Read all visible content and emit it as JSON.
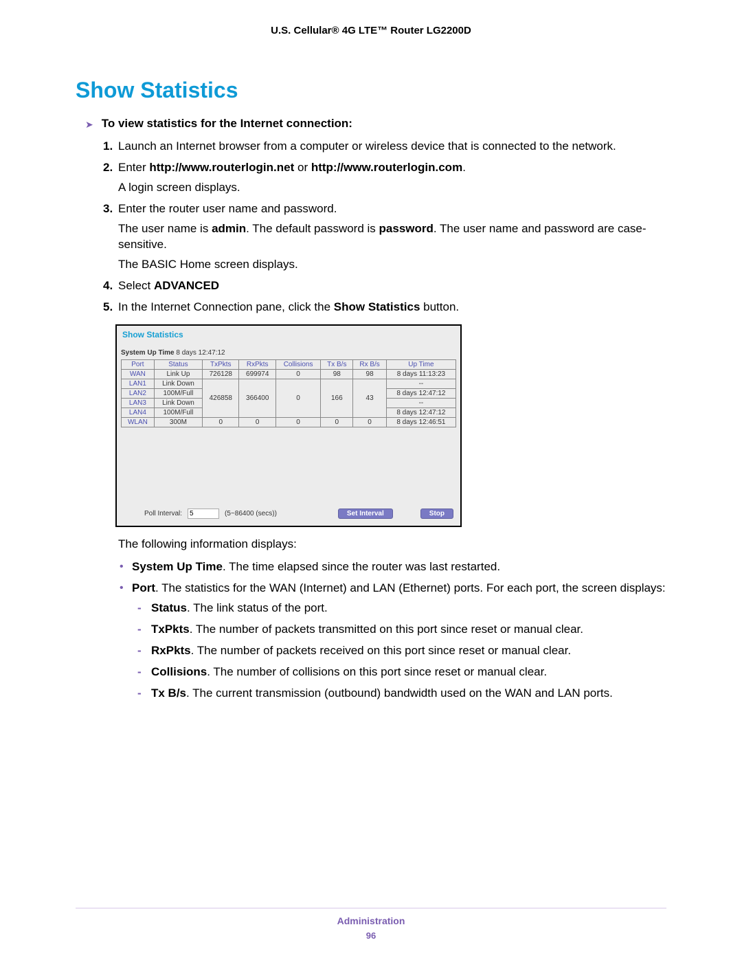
{
  "header": "U.S. Cellular® 4G LTE™ Router LG2200D",
  "section_title": "Show Statistics",
  "lead": "To view statistics for the Internet connection:",
  "steps": {
    "s1": {
      "num": "1.",
      "text": "Launch an Internet browser from a computer or wireless device that is connected to the network."
    },
    "s2": {
      "num": "2.",
      "pre": "Enter ",
      "b1": "http://www.routerlogin.net",
      "mid": " or ",
      "b2": "http://www.routerlogin.com",
      "post": ".",
      "p2": "A login screen displays."
    },
    "s3": {
      "num": "3.",
      "text": "Enter the router user name and password.",
      "p2a": "The user name is ",
      "p2b1": "admin",
      "p2c": ". The default password is ",
      "p2b2": "password",
      "p2d": ". The user name and password are case-sensitive.",
      "p3": "The BASIC Home screen displays."
    },
    "s4": {
      "num": "4.",
      "pre": "Select ",
      "b": "ADVANCED"
    },
    "s5": {
      "num": "5.",
      "pre": "In the Internet Connection pane, click the ",
      "b": "Show Statistics",
      "post": " button."
    }
  },
  "panel": {
    "title": "Show Statistics",
    "uptime_label": "System Up Time",
    "uptime_value": "8 days 12:47:12",
    "headers": [
      "Port",
      "Status",
      "TxPkts",
      "RxPkts",
      "Collisions",
      "Tx B/s",
      "Rx B/s",
      "Up Time"
    ],
    "rows": [
      [
        "WAN",
        "Link Up",
        "726128",
        "699974",
        "0",
        "98",
        "98",
        "8 days 11:13:23"
      ],
      [
        "LAN1",
        "Link Down",
        "",
        "",
        "",
        "",
        "",
        "--"
      ],
      [
        "LAN2",
        "100M/Full",
        "426858",
        "366400",
        "0",
        "166",
        "43",
        "8 days 12:47:12"
      ],
      [
        "LAN3",
        "Link Down",
        "",
        "",
        "",
        "",
        "",
        "--"
      ],
      [
        "LAN4",
        "100M/Full",
        "",
        "",
        "",
        "",
        "",
        "8 days 12:47:12"
      ],
      [
        "WLAN",
        "300M",
        "0",
        "0",
        "0",
        "0",
        "0",
        "8 days 12:46:51"
      ]
    ],
    "poll_label": "Poll Interval:",
    "poll_value": "5",
    "poll_hint": "(5~86400 (secs))",
    "btn_set": "Set Interval",
    "btn_stop": "Stop"
  },
  "after_fig": "The following information displays:",
  "bullets": {
    "b1": {
      "b": "System Up Time",
      "t": ". The time elapsed since the router was last restarted."
    },
    "b2": {
      "b": "Port",
      "t": ". The statistics for the WAN (Internet) and LAN (Ethernet) ports. For each port, the screen displays:"
    }
  },
  "dashes": {
    "d1": {
      "b": "Status",
      "t": ". The link status of the port."
    },
    "d2": {
      "b": "TxPkts",
      "t": ". The number of packets transmitted on this port since reset or manual clear."
    },
    "d3": {
      "b": "RxPkts",
      "t": ". The number of packets received on this port since reset or manual clear."
    },
    "d4": {
      "b": "Collisions",
      "t": ". The number of collisions on this port since reset or manual clear."
    },
    "d5": {
      "b": "Tx B/s",
      "t": ". The current transmission (outbound) bandwidth used on the WAN and LAN ports."
    }
  },
  "footer": {
    "label": "Administration",
    "page": "96"
  }
}
